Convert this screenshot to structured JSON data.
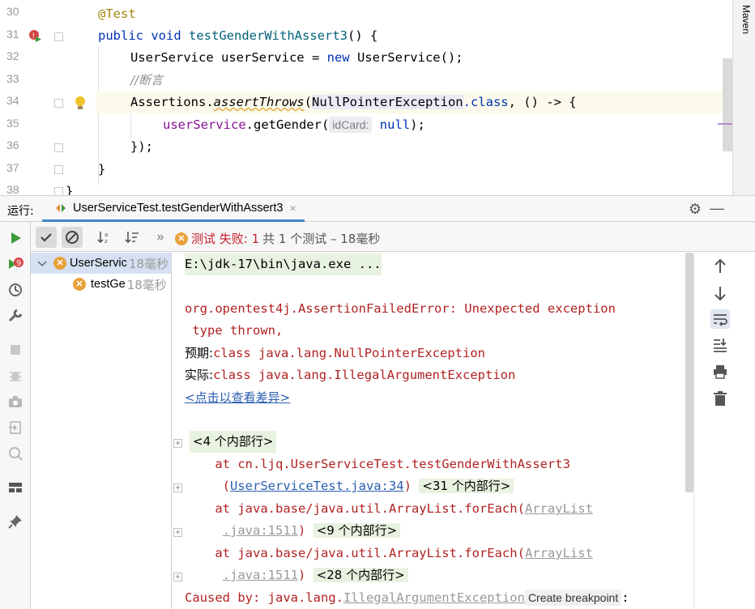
{
  "editor": {
    "line_numbers": [
      "30",
      "31",
      "32",
      "33",
      "34",
      "35",
      "36",
      "37",
      "38"
    ],
    "line30": {
      "annotation": "@Test"
    },
    "line31": {
      "kw_public": "public",
      "kw_void": "void",
      "method": "testGenderWithAssert3",
      "rest": "() {"
    },
    "line32": {
      "type": "UserService",
      "decl": " userService = ",
      "kw_new": "new",
      "ctor": " UserService();"
    },
    "line33": {
      "comment": "//断言"
    },
    "line34": {
      "cls": "Assertions.",
      "method": "assertThrows",
      "open": "(",
      "arg": "NullPointerException",
      "kw_class": ".class",
      "rest": ", () -> {"
    },
    "line35": {
      "field": "userService",
      "call": ".getGender(",
      "hint": "idCard:",
      "kw_null": "null",
      "close": ");"
    },
    "line36": {
      "text": "});"
    },
    "line37": {
      "text": "}"
    },
    "line38": {
      "text": "}"
    },
    "maven_label": "Maven"
  },
  "run_header": {
    "label": "运行:",
    "tab_title": "UserServiceTest.testGenderWithAssert3",
    "close": "×"
  },
  "test_toolbar": {
    "more": "»",
    "status_fail_label": "测试 失败: 1",
    "status_summary": "共 1 个测试 – 18毫秒"
  },
  "tree": {
    "root": {
      "label": "UserServic",
      "time": "18毫秒"
    },
    "child": {
      "label": "testGe",
      "time": "18毫秒"
    }
  },
  "console": {
    "line1": "E:\\jdk-17\\bin\\java.exe ...",
    "line2": "org.opentest4j.AssertionFailedError: Unexpected exception",
    "line3": " type thrown,",
    "line4_label": "预期:",
    "line4_value": "class java.lang.NullPointerException",
    "line5_label": "实际:",
    "line5_value": "class java.lang.IllegalArgumentException",
    "diff_link": "<点击以查看差异>",
    "fold1": "<4 个内部行>",
    "at1": "    at cn.ljq.UserServiceTest.testGenderWithAssert3",
    "at1_open": "     (",
    "at1_link": "UserServiceTest.java:34",
    "at1_close": ")",
    "fold2": "<31 个内部行>",
    "at2": "    at java.base/java.util.ArrayList.forEach(",
    "at2_link_a": "ArrayList",
    "at2_link_b": ".java:1511",
    "at2_close": ")",
    "fold3": "<9 个内部行>",
    "at3": "    at java.base/java.util.ArrayList.forEach(",
    "at3_link_a": "ArrayList",
    "at3_link_b": ".java:1511",
    "at3_close": ")",
    "fold4": "<28 个内部行>",
    "caused": "Caused by: java.lang.",
    "caused_link": "IllegalArgumentException",
    "bp_tip": "Create breakpoint",
    "caused_tail": ":"
  },
  "colors": {
    "accent": "#4083c9",
    "fail": "#c7222d",
    "run_green": "#3d9b3d"
  }
}
